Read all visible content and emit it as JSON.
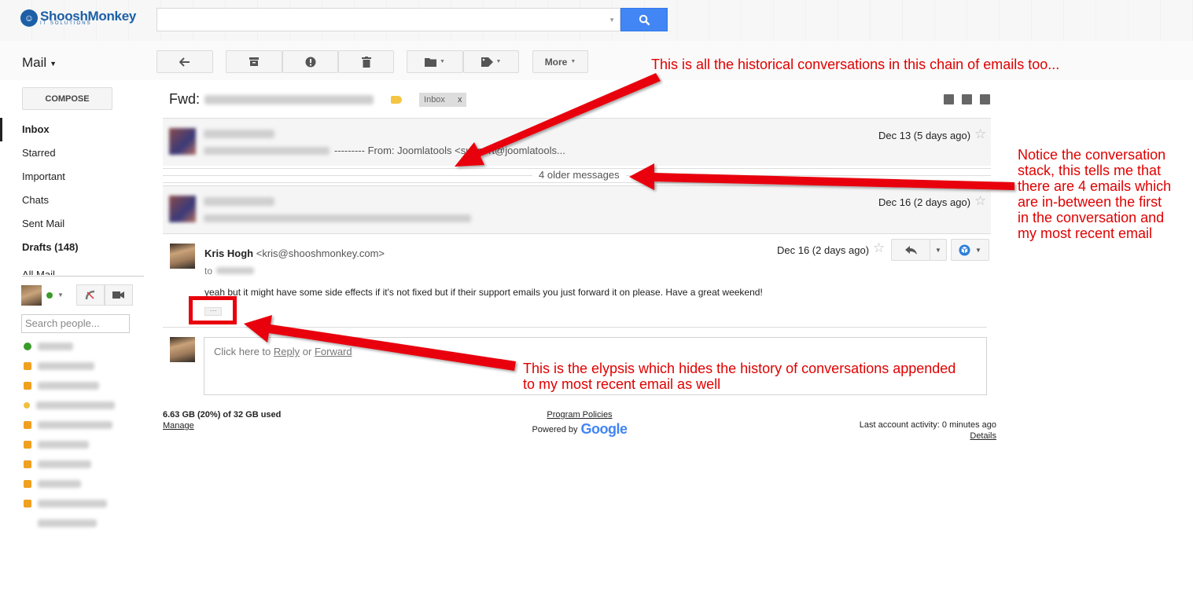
{
  "brand": {
    "name": "ShooshMonkey",
    "tagline": "IT SOLUTIONS"
  },
  "header": {
    "app_label": "Mail"
  },
  "toolbar": {
    "more_label": "More"
  },
  "sidebar": {
    "compose_label": "COMPOSE",
    "items": [
      {
        "label": "Inbox",
        "state": "active"
      },
      {
        "label": "Starred"
      },
      {
        "label": "Important"
      },
      {
        "label": "Chats"
      },
      {
        "label": "Sent Mail"
      },
      {
        "label": "Drafts (148)",
        "state": "bold"
      },
      {
        "label": "All Mail"
      }
    ],
    "search_people_placeholder": "Search people..."
  },
  "thread": {
    "subject_prefix": "Fwd:",
    "label_chip": "Inbox",
    "label_chip_close": "x",
    "collapsed_messages": [
      {
        "date": "Dec 13 (5 days ago)",
        "snippet": "--------- From: Joomlatools <support@joomlatools..."
      },
      {
        "date": "Dec 16 (2 days ago)",
        "snippet": ""
      }
    ],
    "older_messages_label": "4 older messages",
    "open_message": {
      "sender_name": "Kris Hogh",
      "sender_email": "<kris@shooshmonkey.com>",
      "to_prefix": "to",
      "date": "Dec 16 (2 days ago)",
      "body": "yeah but it might have some side effects if it's not fixed but if their support emails you just forward it on please. Have a great weekend!",
      "ellipsis": "···"
    },
    "reply": {
      "prefix": "Click here to",
      "reply_link": "Reply",
      "or": "or",
      "forward_link": "Forward"
    }
  },
  "footer": {
    "storage": "6.63 GB (20%) of 32 GB used",
    "manage": "Manage",
    "policies": "Program Policies",
    "powered_by": "Powered by",
    "google": "Google",
    "activity": "Last account activity: 0 minutes ago",
    "details": "Details"
  },
  "annotations": {
    "top": "This is all the historical conversations in this chain of emails too...",
    "right": [
      "Notice the conversation",
      "stack, this tells me that",
      "there are 4 emails which",
      "are in-between the first",
      "in the conversation and",
      "my most recent email"
    ],
    "bottom": [
      "This is the elypsis which hides the history of conversations appended",
      "to my most recent email as well"
    ]
  },
  "colors": {
    "accent": "#4285f4",
    "annotation": "#e00000",
    "label_tag": "#f4c542"
  }
}
